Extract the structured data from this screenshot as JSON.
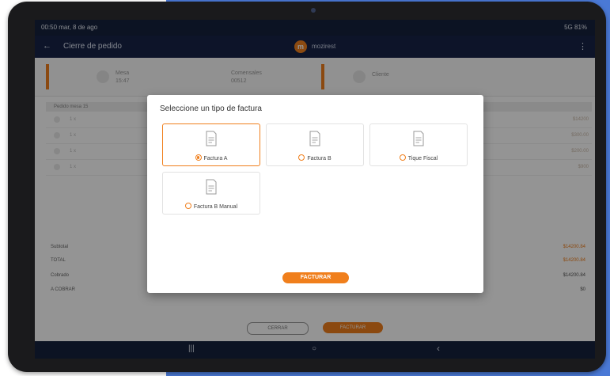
{
  "status_bar": {
    "time_date": "00:50 mar, 8 de ago",
    "signal": "5G 81%"
  },
  "app_bar": {
    "title": "Cierre de pedido",
    "brand_initial": "m",
    "brand_name": "mozirest"
  },
  "info": {
    "mesa_label": "Mesa",
    "mesa_value": "15:47",
    "comensales_label": "Comensales",
    "comensales_value": "00512",
    "cliente_label": "Cliente"
  },
  "list_header": "Pedido mesa 15",
  "items": [
    {
      "qty": "1 x",
      "price": "$14200"
    },
    {
      "qty": "1 x",
      "price": "$300.00"
    },
    {
      "qty": "1 x",
      "price": "$200.00"
    },
    {
      "qty": "1 x",
      "price": "$900"
    }
  ],
  "totals": {
    "subtotal_label": "Subtotal",
    "subtotal_value": "$14200.84",
    "total_label": "TOTAL",
    "total_value": "$14200.84",
    "cobrado_label": "Cobrado",
    "cobrado_value": "$14200.84",
    "a_cobrar_label": "A COBRAR",
    "a_cobrar_value": "$0"
  },
  "bottom_buttons": {
    "cerrar": "CERRAR",
    "facturar": "FACTURAR"
  },
  "dialog": {
    "title": "Seleccione un tipo de factura",
    "options": [
      {
        "label": "Factura A",
        "selected": true
      },
      {
        "label": "Factura B",
        "selected": false
      },
      {
        "label": "Tique Fiscal",
        "selected": false
      },
      {
        "label": "Factura B Manual",
        "selected": false
      }
    ],
    "action": "FACTURAR"
  },
  "nav": {
    "recents": "|||",
    "home": "○",
    "back": "‹"
  },
  "colors": {
    "accent": "#f07f1c",
    "appbar": "#172448",
    "statusbar": "#15213d",
    "background_panel": "#4a79d6"
  }
}
